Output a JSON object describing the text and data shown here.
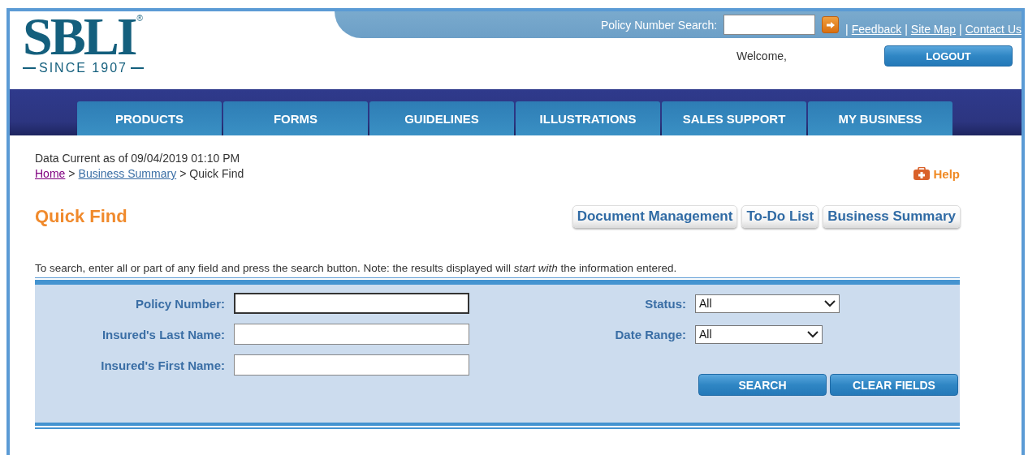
{
  "logo": {
    "name": "SBLI",
    "mark": "®",
    "tagline": "SINCE 1907"
  },
  "top_bar": {
    "search_label": "Policy Number Search:",
    "links": [
      "Feedback",
      "Site Map",
      "Contact Us"
    ],
    "separator": "|"
  },
  "welcome": "Welcome,",
  "logout": "LOGOUT",
  "nav": [
    {
      "label": "PRODUCTS"
    },
    {
      "label": "FORMS"
    },
    {
      "label": "GUIDELINES"
    },
    {
      "label": "ILLUSTRATIONS"
    },
    {
      "label": "SALES SUPPORT"
    },
    {
      "label": "MY BUSINESS"
    }
  ],
  "data_current": "Data Current as of 09/04/2019 01:10 PM",
  "breadcrumb": [
    {
      "label": "Home",
      "kind": "visited"
    },
    {
      "label": "Business Summary",
      "kind": "link"
    },
    {
      "label": "Quick Find",
      "kind": "current"
    }
  ],
  "breadcrumb_separator": ">",
  "help": "Help",
  "title": "Quick Find",
  "page_buttons": [
    "Document Management",
    "To-Do List",
    "Business Summary"
  ],
  "instructions": "To search, enter all or part of any field and press the search button. Note: the results displayed will *start with* the information entered.",
  "left_fields": [
    {
      "label": "Policy Number:",
      "focused": true
    },
    {
      "label": "Insured's Last Name:",
      "focused": false
    },
    {
      "label": "Insured's First Name:",
      "focused": false
    }
  ],
  "right_fields": [
    {
      "label": "Status:",
      "value": "All",
      "kind": "wide"
    },
    {
      "label": "Date Range:",
      "value": "All",
      "kind": "narrow"
    }
  ],
  "buttons": [
    "SEARCH",
    "CLEAR FIELDS"
  ]
}
